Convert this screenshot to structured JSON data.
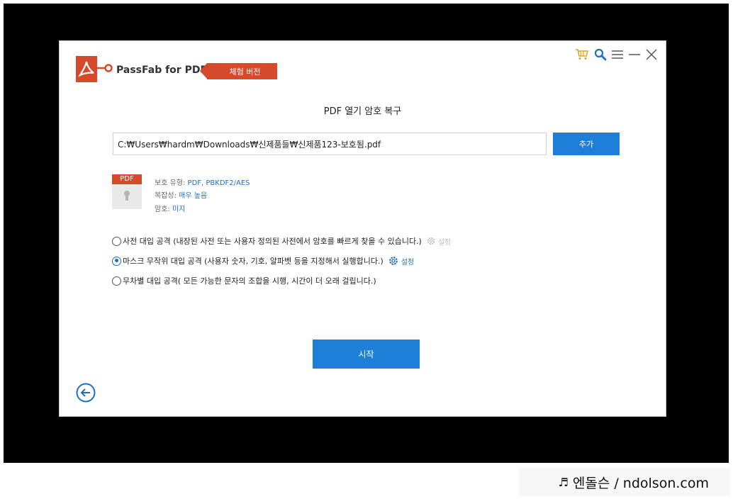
{
  "app": {
    "title": "PassFab for PDF",
    "trial_badge": "체험 버전"
  },
  "page": {
    "title": "PDF 열기 암호 복구"
  },
  "file": {
    "path": "C:₩Users₩hardm₩Downloads₩신제품들₩신제품123-보호됨.pdf",
    "add_label": "추가",
    "icon_label": "PDF",
    "protection_label": "보호 유형:",
    "protection_value": "PDF, PBKDF2/AES",
    "complexity_label": "복잡성:",
    "complexity_value": "매우 높음",
    "password_label": "암호:",
    "password_value": "미지"
  },
  "options": [
    {
      "label": "사전 대입 공격 (내장된 사전 또는 사용자 정의된 사전에서 암호를 빠르게 찾을 수 있습니다.)",
      "settings_label": "설정",
      "selected": false,
      "settings_enabled": false
    },
    {
      "label": "마스크 무작위 대입 공격 (사용자 숫자, 기호, 알파벳 등을 지정해서 실행합니다.)",
      "settings_label": "설정",
      "selected": true,
      "settings_enabled": true
    },
    {
      "label": "무차별 대입 공격( 모든 가능한 문자의 조합을 시행, 시간이 더 오래 걸립니다.)",
      "selected": false
    }
  ],
  "start_label": "시작",
  "watermark": {
    "icon": "♬",
    "text": "엔돌슨 / ndolson.com"
  },
  "icons": {
    "cart": "cart-icon",
    "search": "search-icon",
    "menu": "menu-icon",
    "minimize": "minimize-icon",
    "close": "close-icon",
    "back": "back-arrow-icon",
    "gear": "gear-icon",
    "lock": "lock-icon"
  },
  "colors": {
    "brand": "#d64a2c",
    "accent": "#1d7fd8",
    "link": "#1d6fc0",
    "cart": "#e6a21a",
    "disabled": "#bdbdbd"
  }
}
